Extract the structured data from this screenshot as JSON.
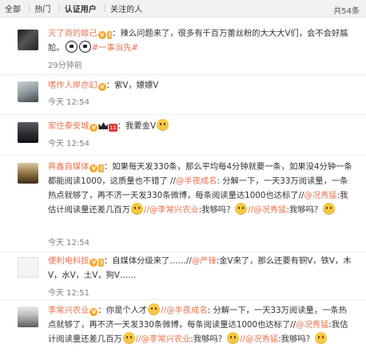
{
  "filter": {
    "tabs": [
      {
        "label": "全部"
      },
      {
        "label": "热门"
      },
      {
        "label": "认证用户"
      },
      {
        "label": "关注的人"
      }
    ],
    "total": "共54条"
  },
  "comments": [
    {
      "user": "灭了商的姬己",
      "text_a": "：辣么问题来了，很多有千百万蕾丝粉的大大大V们，会不会好尴尬。",
      "topic": "#一事当先#",
      "time": "29分钟前"
    },
    {
      "user": "嗜作人岸亦幻",
      "text_a": "：紫V，嫖嫖V",
      "time": "今天 12:54"
    },
    {
      "user": "家住泰安城",
      "vip": "11",
      "text_a": "：我要金V",
      "time": "今天 12:54"
    },
    {
      "user": "蒋鑫自媒体",
      "text_a": "：如果每天发330条，那么平均每4分钟就要一条，如果没4分钟一条都能阅读1000，这质量也不错了 //",
      "mention_a": "@半夜成名",
      "text_b": ": 分解一下，一天33万阅读量，一条热点就够了，再不济一天发330条微博，每条阅读量达1000也达标了//",
      "mention_b": "@况秀猛",
      "text_c": ":我估计阅读量还差几百万",
      "mention_c": "//@李常兴农业",
      "text_d": ":我够吗？",
      "mention_d": "//@况秀猛",
      "text_e": ":我够吗？",
      "time": "今天 12:54"
    },
    {
      "user": "便利电科技",
      "text_a": "：自媒体分级来了……//",
      "mention_a": "@严锋",
      "text_b": ":金V来了，那么还要有铜V，铁V，木V，水V，土V，狗V……",
      "time": "今天 12:51"
    },
    {
      "user": "李常兴农业",
      "text_a": "：你是个人才",
      "mention_a": "//@半夜成名",
      "text_b": ": 分解一下，一天33万阅读量，一条热点就够了，再不济一天发330条微博，每条阅读量达1000也达标了//",
      "mention_b": "@况秀猛",
      "text_c": ":我估计阅读量还差几百万",
      "mention_c": "//@李常兴农业",
      "text_d": ":我够吗？",
      "mention_d": "//@况秀猛",
      "text_e": ":我够吗？"
    }
  ],
  "badges": {
    "v": "V",
    "lv": "3"
  },
  "colors": {
    "link": "#eb7350",
    "badge": "#f5a623",
    "bar": "#f2f2f5"
  }
}
